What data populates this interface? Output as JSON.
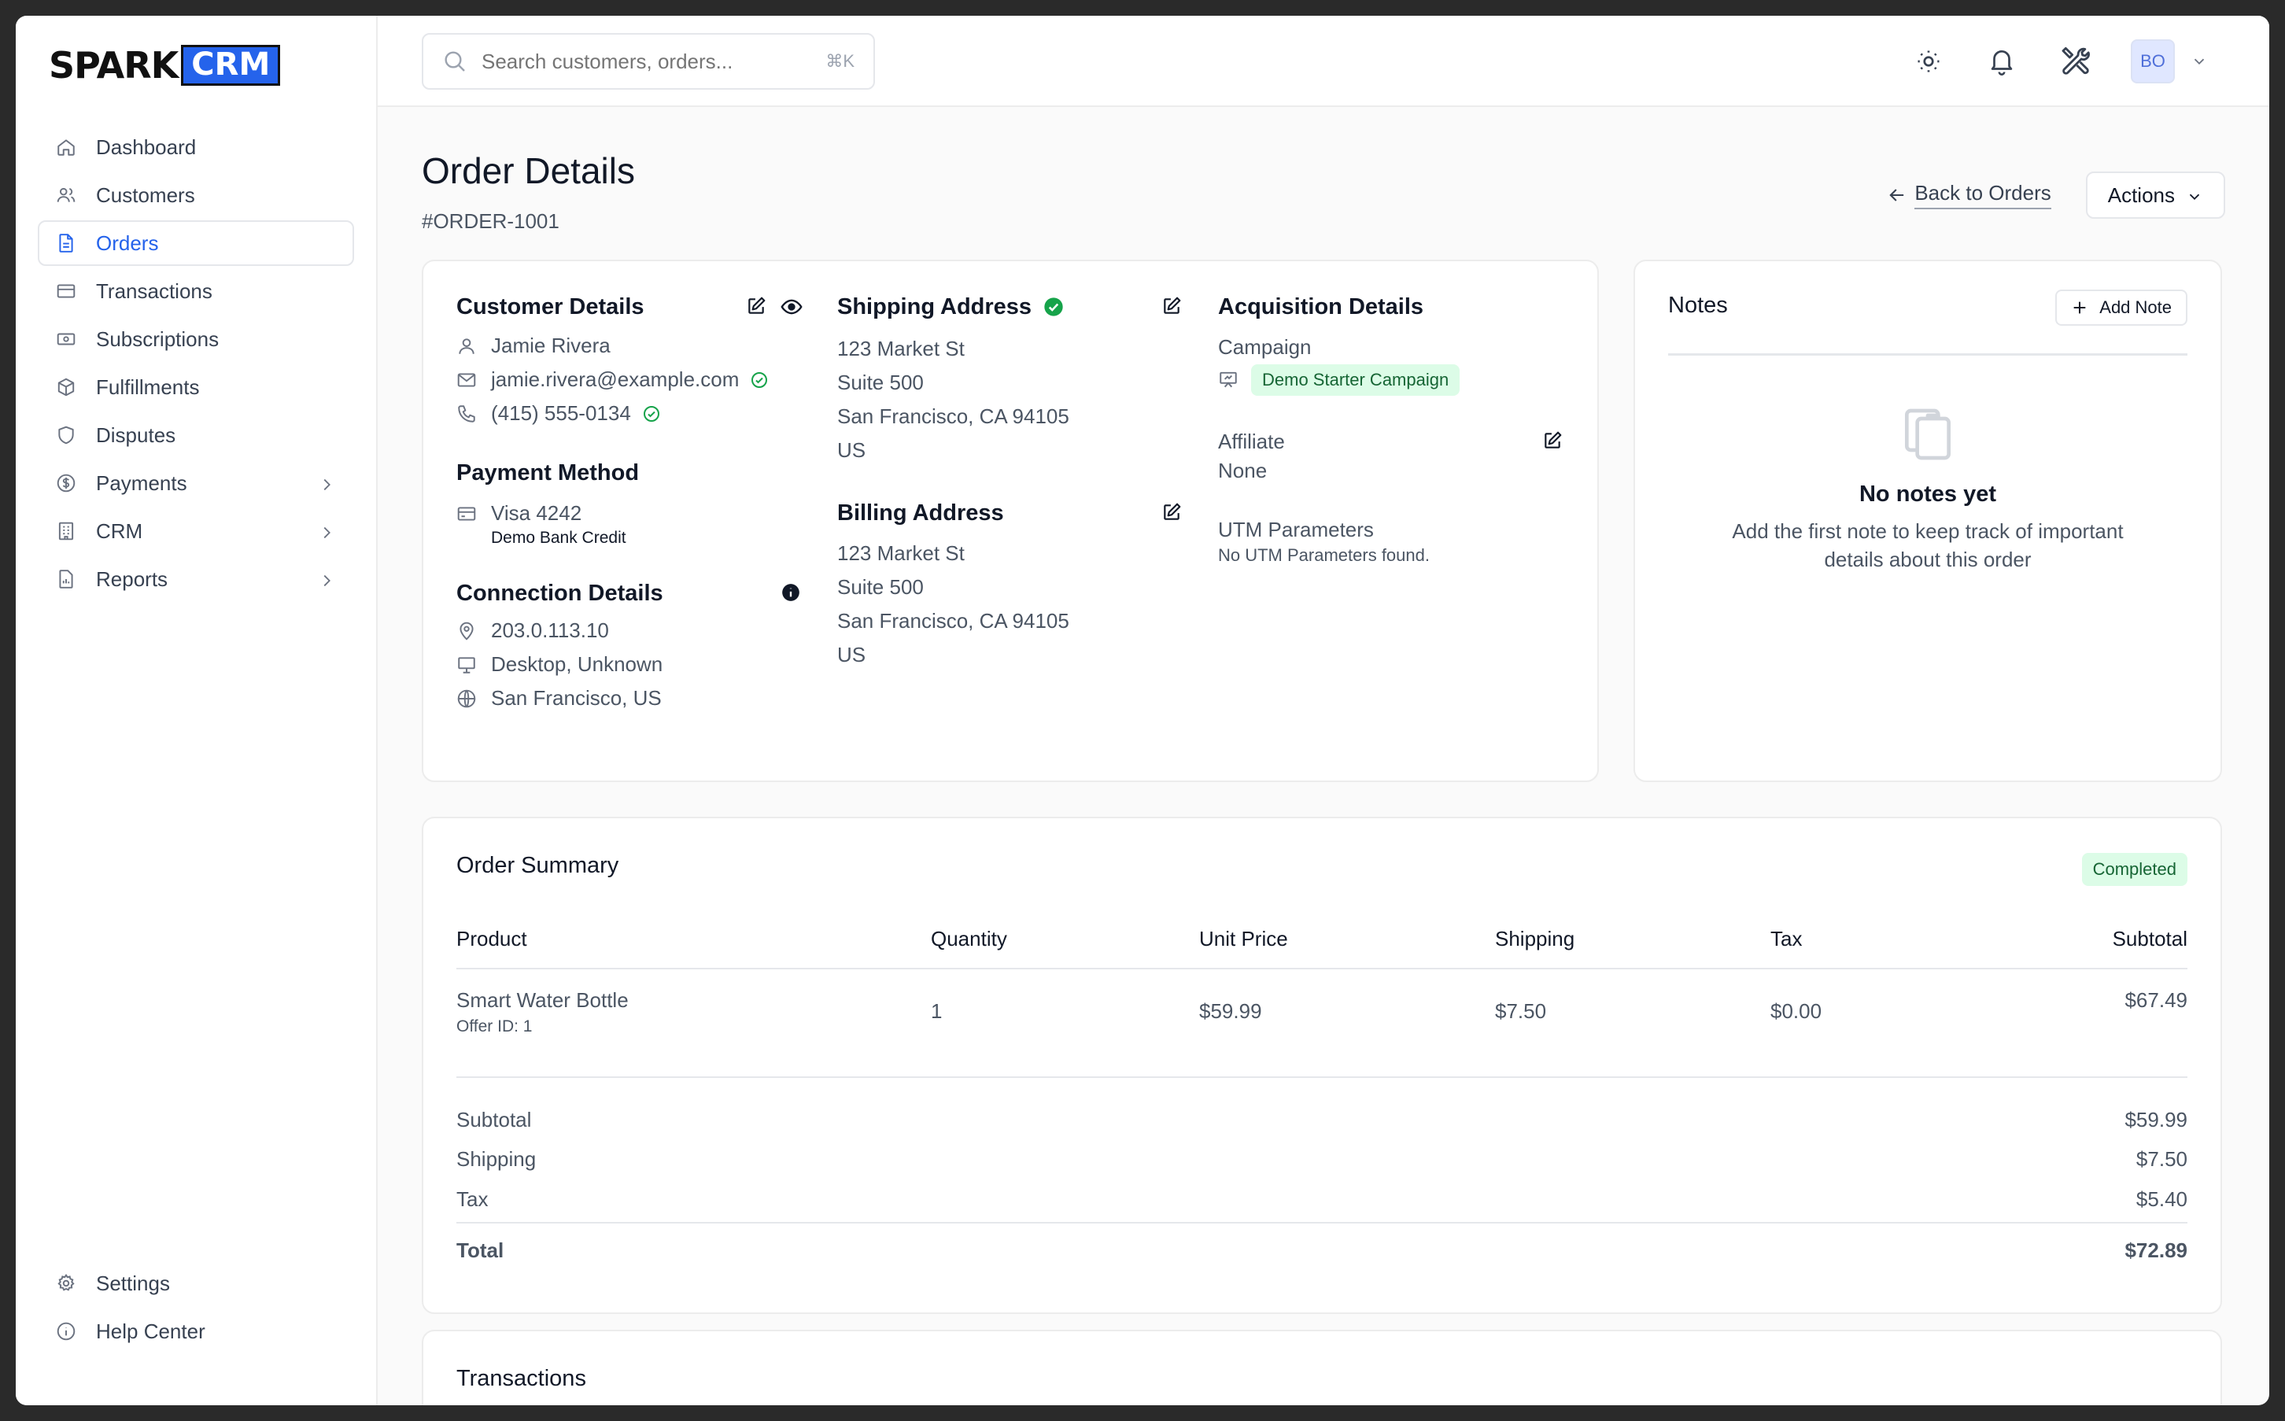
{
  "brand": {
    "spark": "SPARK",
    "crm": "CRM"
  },
  "sidebar": {
    "items": [
      {
        "label": "Dashboard",
        "icon": "home-icon"
      },
      {
        "label": "Customers",
        "icon": "users-icon"
      },
      {
        "label": "Orders",
        "icon": "document-icon",
        "active": true
      },
      {
        "label": "Transactions",
        "icon": "credit-card-icon"
      },
      {
        "label": "Subscriptions",
        "icon": "banknote-icon"
      },
      {
        "label": "Fulfillments",
        "icon": "package-icon"
      },
      {
        "label": "Disputes",
        "icon": "shield-icon"
      },
      {
        "label": "Payments",
        "icon": "dollar-circle-icon",
        "expandable": true
      },
      {
        "label": "CRM",
        "icon": "building-icon",
        "expandable": true
      },
      {
        "label": "Reports",
        "icon": "report-icon",
        "expandable": true
      }
    ],
    "bottom": [
      {
        "label": "Settings",
        "icon": "gear-icon"
      },
      {
        "label": "Help Center",
        "icon": "info-icon"
      }
    ]
  },
  "topbar": {
    "search_placeholder": "Search customers, orders...",
    "shortcut": "⌘K",
    "avatar_initials": "BO"
  },
  "page": {
    "title": "Order Details",
    "order_id": "#ORDER-1001",
    "back_label": "Back to Orders",
    "actions_label": "Actions"
  },
  "customer": {
    "title": "Customer Details",
    "name": "Jamie Rivera",
    "email": "jamie.rivera@example.com",
    "phone": "(415) 555-0134"
  },
  "payment": {
    "title": "Payment Method",
    "card": "Visa 4242",
    "bank": "Demo Bank Credit"
  },
  "connection": {
    "title": "Connection Details",
    "ip": "203.0.113.10",
    "device": "Desktop, Unknown",
    "location": "San Francisco, US"
  },
  "shipping": {
    "title": "Shipping Address",
    "lines": [
      "123 Market St",
      "Suite 500",
      "San Francisco, CA 94105",
      "US"
    ]
  },
  "billing": {
    "title": "Billing Address",
    "lines": [
      "123 Market St",
      "Suite 500",
      "San Francisco, CA 94105",
      "US"
    ]
  },
  "acquisition": {
    "title": "Acquisition Details",
    "campaign_label": "Campaign",
    "campaign_value": "Demo Starter Campaign",
    "affiliate_label": "Affiliate",
    "affiliate_value": "None",
    "utm_label": "UTM Parameters",
    "utm_value": "No UTM Parameters found."
  },
  "notes": {
    "title": "Notes",
    "add_label": "Add Note",
    "empty_title": "No notes yet",
    "empty_desc_1": "Add the first note to keep track of important",
    "empty_desc_2": "details about this order"
  },
  "summary": {
    "title": "Order Summary",
    "status": "Completed",
    "columns": [
      "Product",
      "Quantity",
      "Unit Price",
      "Shipping",
      "Tax",
      "Subtotal"
    ],
    "rows": [
      {
        "product": "Smart Water Bottle",
        "offer": "Offer ID: 1",
        "quantity": "1",
        "unit_price": "$59.99",
        "shipping": "$7.50",
        "tax": "$0.00",
        "subtotal": "$67.49"
      }
    ],
    "totals": [
      {
        "label": "Subtotal",
        "value": "$59.99"
      },
      {
        "label": "Shipping",
        "value": "$7.50"
      },
      {
        "label": "Tax",
        "value": "$5.40"
      }
    ],
    "total_label": "Total",
    "total_value": "$72.89"
  },
  "transactions": {
    "title": "Transactions"
  },
  "colors": {
    "accent": "#2563eb",
    "success": "#16a34a",
    "badge_bg": "#dcfce7",
    "badge_text": "#166534"
  }
}
